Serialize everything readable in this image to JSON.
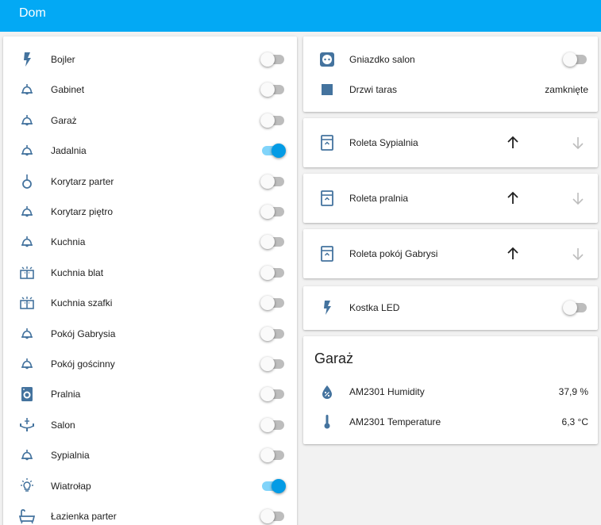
{
  "header": {
    "title": "Dom"
  },
  "lights": [
    {
      "label": "Bojler",
      "icon": "flash-icon",
      "on": false
    },
    {
      "label": "Gabinet",
      "icon": "ceiling-light-icon",
      "on": false
    },
    {
      "label": "Garaż",
      "icon": "ceiling-light-icon",
      "on": false
    },
    {
      "label": "Jadalnia",
      "icon": "ceiling-light-icon",
      "on": true
    },
    {
      "label": "Korytarz parter",
      "icon": "pendant-light-icon",
      "on": false
    },
    {
      "label": "Korytarz piętro",
      "icon": "ceiling-light-icon",
      "on": false
    },
    {
      "label": "Kuchnia",
      "icon": "ceiling-light-icon",
      "on": false
    },
    {
      "label": "Kuchnia blat",
      "icon": "cabinet-light-icon",
      "on": false
    },
    {
      "label": "Kuchnia szafki",
      "icon": "cabinet-light-icon",
      "on": false
    },
    {
      "label": "Pokój Gabrysia",
      "icon": "ceiling-light-icon",
      "on": false
    },
    {
      "label": "Pokój gościnny",
      "icon": "ceiling-light-icon",
      "on": false
    },
    {
      "label": "Pralnia",
      "icon": "washing-machine-icon",
      "on": false
    },
    {
      "label": "Salon",
      "icon": "chandelier-icon",
      "on": false
    },
    {
      "label": "Sypialnia",
      "icon": "ceiling-light-icon",
      "on": false
    },
    {
      "label": "Wiatrołap",
      "icon": "lightbulb-on-icon",
      "on": true
    },
    {
      "label": "Łazienka parter",
      "icon": "bathtub-icon",
      "on": false
    }
  ],
  "devices": {
    "socket": {
      "label": "Gniazdko salon",
      "icon": "power-socket-icon",
      "on": false
    },
    "door": {
      "label": "Drzwi taras",
      "icon": "door-square-icon",
      "state": "zamknięte"
    }
  },
  "covers": [
    {
      "label": "Roleta Sypialnia",
      "icon": "window-shutter-icon"
    },
    {
      "label": "Roleta pralnia",
      "icon": "window-shutter-icon"
    },
    {
      "label": "Roleta pokój Gabrysi",
      "icon": "window-shutter-icon"
    }
  ],
  "led": {
    "label": "Kostka LED",
    "icon": "flash-icon",
    "on": false
  },
  "garage": {
    "title": "Garaż",
    "sensors": [
      {
        "label": "AM2301 Humidity",
        "icon": "water-percent-icon",
        "value": "37,9 %"
      },
      {
        "label": "AM2301 Temperature",
        "icon": "thermometer-icon",
        "value": "6,3 °C"
      }
    ]
  },
  "colors": {
    "header": "#03a9f4",
    "icon": "#44739e",
    "toggle_on": "#039be5",
    "toggle_on_track": "#81d4fa"
  }
}
